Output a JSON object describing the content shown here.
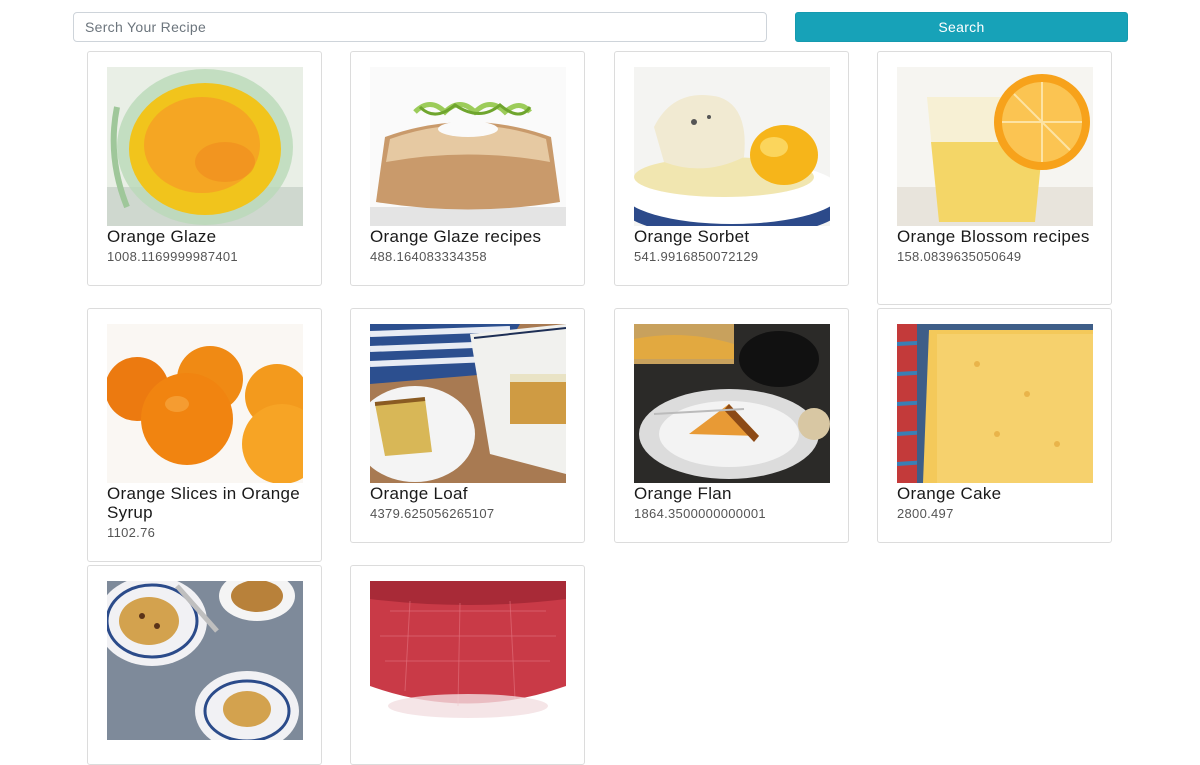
{
  "search": {
    "placeholder": "Serch Your Recipe",
    "value": "",
    "button_label": "Search"
  },
  "colors": {
    "accent": "#17a2b8"
  },
  "recipes": [
    {
      "title": "Orange Glaze",
      "value": "1008.1169999987401",
      "image": "orange-glaze-photo"
    },
    {
      "title": "Orange Glaze recipes",
      "value": "488.164083334358",
      "image": "bundt-cake-photo"
    },
    {
      "title": "Orange Sorbet",
      "value": "541.9916850072129",
      "image": "sorbet-plate-photo"
    },
    {
      "title": "Orange Blossom recipes",
      "value": "158.0839635050649",
      "image": "orange-drink-photo"
    },
    {
      "title": "Orange Slices in Orange Syrup",
      "value": "1102.76",
      "image": "oranges-photo"
    },
    {
      "title": "Orange Loaf",
      "value": "4379.625056265107",
      "image": "loaf-slice-photo"
    },
    {
      "title": "Orange Flan",
      "value": "1864.3500000000001",
      "image": "flan-plate-photo"
    },
    {
      "title": "Orange Cake",
      "value": "2800.497",
      "image": "cake-pan-photo"
    },
    {
      "title": "",
      "value": "",
      "image": "scones-photo"
    },
    {
      "title": "",
      "value": "",
      "image": "red-drink-photo"
    }
  ]
}
